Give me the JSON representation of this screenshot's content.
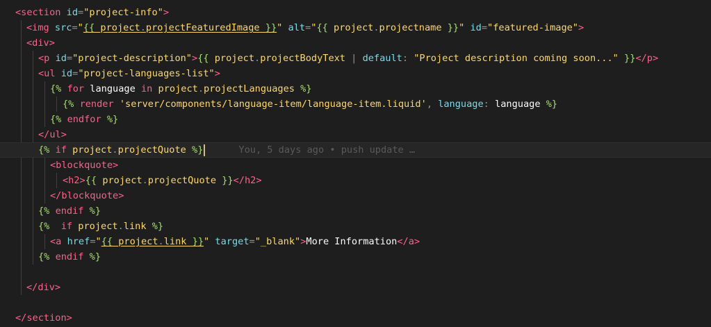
{
  "editor": {
    "lines": [
      [
        {
          "t": "<section ",
          "c": "t-tag"
        },
        {
          "t": "id",
          "c": "t-attr"
        },
        {
          "t": "=",
          "c": "t-punc"
        },
        {
          "t": "\"project-info\"",
          "c": "t-str"
        },
        {
          "t": ">",
          "c": "t-tag"
        }
      ],
      [
        {
          "t": "<img ",
          "c": "t-tag"
        },
        {
          "t": "src",
          "c": "t-attr"
        },
        {
          "t": "=",
          "c": "t-punc"
        },
        {
          "t": "\"",
          "c": "t-str"
        },
        {
          "t": "{{ ",
          "c": "t-dlm u"
        },
        {
          "t": "project",
          "c": "t-prop u"
        },
        {
          "t": ".",
          "c": "t-punc u"
        },
        {
          "t": "projectFeaturedImage",
          "c": "t-prop u"
        },
        {
          "t": " }}",
          "c": "t-dlm u"
        },
        {
          "t": "\"",
          "c": "t-str"
        },
        {
          "t": " alt",
          "c": "t-attr"
        },
        {
          "t": "=",
          "c": "t-punc"
        },
        {
          "t": "\"",
          "c": "t-str"
        },
        {
          "t": "{{ ",
          "c": "t-dlm"
        },
        {
          "t": "project",
          "c": "t-prop"
        },
        {
          "t": ".",
          "c": "t-punc"
        },
        {
          "t": "projectname",
          "c": "t-prop"
        },
        {
          "t": " }}",
          "c": "t-dlm"
        },
        {
          "t": "\"",
          "c": "t-str"
        },
        {
          "t": " id",
          "c": "t-attr"
        },
        {
          "t": "=",
          "c": "t-punc"
        },
        {
          "t": "\"featured-image\"",
          "c": "t-str"
        },
        {
          "t": ">",
          "c": "t-tag"
        }
      ],
      [
        {
          "t": "<div>",
          "c": "t-tag"
        }
      ],
      [
        {
          "t": "<p ",
          "c": "t-tag"
        },
        {
          "t": "id",
          "c": "t-attr"
        },
        {
          "t": "=",
          "c": "t-punc"
        },
        {
          "t": "\"project-description\"",
          "c": "t-str"
        },
        {
          "t": ">",
          "c": "t-tag"
        },
        {
          "t": "{{ ",
          "c": "t-dlm"
        },
        {
          "t": "project",
          "c": "t-prop"
        },
        {
          "t": ".",
          "c": "t-punc"
        },
        {
          "t": "projectBodyText",
          "c": "t-prop"
        },
        {
          "t": " | ",
          "c": "t-punc"
        },
        {
          "t": "default",
          "c": "t-fn"
        },
        {
          "t": ": ",
          "c": "t-punc"
        },
        {
          "t": "\"Project description coming soon...\"",
          "c": "t-str"
        },
        {
          "t": " }}",
          "c": "t-dlm"
        },
        {
          "t": "</p>",
          "c": "t-tag"
        }
      ],
      [
        {
          "t": "<ul ",
          "c": "t-tag"
        },
        {
          "t": "id",
          "c": "t-attr"
        },
        {
          "t": "=",
          "c": "t-punc"
        },
        {
          "t": "\"project-languages-list\"",
          "c": "t-str"
        },
        {
          "t": ">",
          "c": "t-tag"
        }
      ],
      [
        {
          "t": "{% ",
          "c": "t-dlm"
        },
        {
          "t": "for",
          "c": "t-kw"
        },
        {
          "t": " language ",
          "c": "t-var"
        },
        {
          "t": "in",
          "c": "t-kw"
        },
        {
          "t": " project",
          "c": "t-prop"
        },
        {
          "t": ".",
          "c": "t-punc"
        },
        {
          "t": "projectLanguages",
          "c": "t-prop"
        },
        {
          "t": " %}",
          "c": "t-dlm"
        }
      ],
      [
        {
          "t": "{% ",
          "c": "t-dlm"
        },
        {
          "t": "render",
          "c": "t-kw"
        },
        {
          "t": " 'server/components/language-item/language-item.liquid'",
          "c": "t-str"
        },
        {
          "t": ", ",
          "c": "t-punc"
        },
        {
          "t": "language",
          "c": "t-fn"
        },
        {
          "t": ": ",
          "c": "t-punc"
        },
        {
          "t": "language",
          "c": "t-var"
        },
        {
          "t": " %}",
          "c": "t-dlm"
        }
      ],
      [
        {
          "t": "{% ",
          "c": "t-dlm"
        },
        {
          "t": "endfor",
          "c": "t-kw"
        },
        {
          "t": " %}",
          "c": "t-dlm"
        }
      ],
      [
        {
          "t": "</ul>",
          "c": "t-tag"
        }
      ],
      [
        {
          "t": "{% ",
          "c": "t-dlm"
        },
        {
          "t": "if",
          "c": "t-kw"
        },
        {
          "t": " project",
          "c": "t-prop"
        },
        {
          "t": ".",
          "c": "t-punc"
        },
        {
          "t": "projectQuote",
          "c": "t-prop"
        },
        {
          "t": " %}",
          "c": "t-dlm"
        }
      ],
      [
        {
          "t": "<blockquote>",
          "c": "t-tag"
        }
      ],
      [
        {
          "t": "<h2>",
          "c": "t-tag"
        },
        {
          "t": "{{ ",
          "c": "t-dlm"
        },
        {
          "t": "project",
          "c": "t-prop"
        },
        {
          "t": ".",
          "c": "t-punc"
        },
        {
          "t": "projectQuote",
          "c": "t-prop"
        },
        {
          "t": " }}",
          "c": "t-dlm"
        },
        {
          "t": "</h2>",
          "c": "t-tag"
        }
      ],
      [
        {
          "t": "</blockquote>",
          "c": "t-tag"
        }
      ],
      [
        {
          "t": "{% ",
          "c": "t-dlm"
        },
        {
          "t": "endif",
          "c": "t-kw"
        },
        {
          "t": " %}",
          "c": "t-dlm"
        }
      ],
      [
        {
          "t": "{%  ",
          "c": "t-dlm"
        },
        {
          "t": "if",
          "c": "t-kw"
        },
        {
          "t": " project",
          "c": "t-prop"
        },
        {
          "t": ".",
          "c": "t-punc"
        },
        {
          "t": "link",
          "c": "t-prop"
        },
        {
          "t": " %}",
          "c": "t-dlm"
        }
      ],
      [
        {
          "t": "<a ",
          "c": "t-tag"
        },
        {
          "t": "href",
          "c": "t-attr"
        },
        {
          "t": "=",
          "c": "t-punc"
        },
        {
          "t": "\"",
          "c": "t-str"
        },
        {
          "t": "{{ ",
          "c": "t-dlm u"
        },
        {
          "t": "project",
          "c": "t-prop u"
        },
        {
          "t": ".",
          "c": "t-punc u"
        },
        {
          "t": "link",
          "c": "t-prop u"
        },
        {
          "t": " }}",
          "c": "t-dlm u"
        },
        {
          "t": "\"",
          "c": "t-str"
        },
        {
          "t": " target",
          "c": "t-attr"
        },
        {
          "t": "=",
          "c": "t-punc"
        },
        {
          "t": "\"_blank\"",
          "c": "t-str"
        },
        {
          "t": ">",
          "c": "t-tag"
        },
        {
          "t": "More Information",
          "c": "t-text"
        },
        {
          "t": "</a>",
          "c": "t-tag"
        }
      ],
      [
        {
          "t": "{% ",
          "c": "t-dlm"
        },
        {
          "t": "endif",
          "c": "t-kw"
        },
        {
          "t": " %}",
          "c": "t-dlm"
        }
      ],
      [],
      [
        {
          "t": "</div>",
          "c": "t-tag"
        }
      ],
      [],
      [
        {
          "t": "</section>",
          "c": "t-tag"
        }
      ]
    ],
    "current_line": 9,
    "blame_text": "You, 5 days ago • push update …",
    "colors": {
      "background": "#1e1e1e",
      "tag": "#ff6188",
      "attribute": "#78dce8",
      "string": "#ffd866",
      "delimiter": "#a9dc76",
      "blame": "#5a5a5a"
    }
  }
}
